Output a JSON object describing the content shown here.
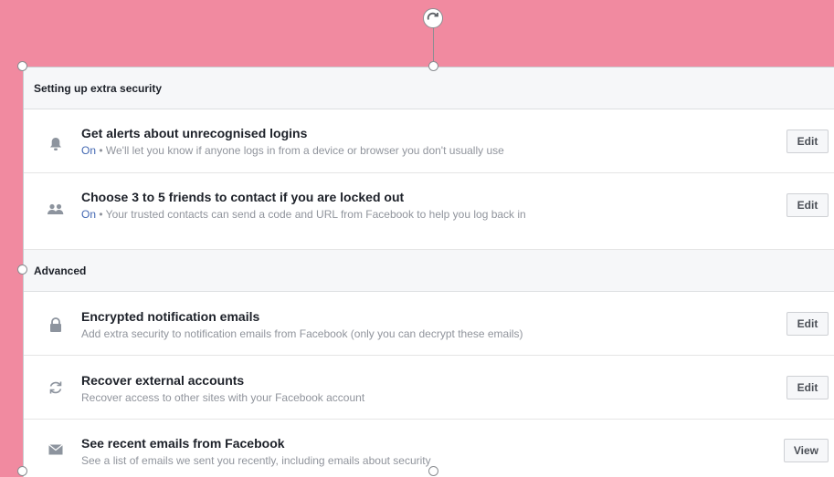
{
  "sections": {
    "extra_security": {
      "title": "Setting up extra security",
      "rows": [
        {
          "title": "Get alerts about unrecognised logins",
          "status": "On",
          "description": " • We'll let you know if anyone logs in from a device or browser you don't usually use",
          "button": "Edit",
          "icon": "bell-icon"
        },
        {
          "title": "Choose 3 to 5 friends to contact if you are locked out",
          "status": "On",
          "description": " • Your trusted contacts can send a code and URL from Facebook to help you log back in",
          "button": "Edit",
          "icon": "friends-icon"
        }
      ]
    },
    "advanced": {
      "title": "Advanced",
      "rows": [
        {
          "title": "Encrypted notification emails",
          "description": "Add extra security to notification emails from Facebook (only you can decrypt these emails)",
          "button": "Edit",
          "icon": "lock-icon"
        },
        {
          "title": "Recover external accounts",
          "description": "Recover access to other sites with your Facebook account",
          "button": "Edit",
          "icon": "refresh-icon"
        },
        {
          "title": "See recent emails from Facebook",
          "description": "See a list of emails we sent you recently, including emails about security",
          "button": "View",
          "icon": "envelope-icon"
        }
      ]
    }
  },
  "colors": {
    "background": "#f18aa0",
    "status_on": "#4267b2",
    "header_bg": "#f6f7f9"
  }
}
